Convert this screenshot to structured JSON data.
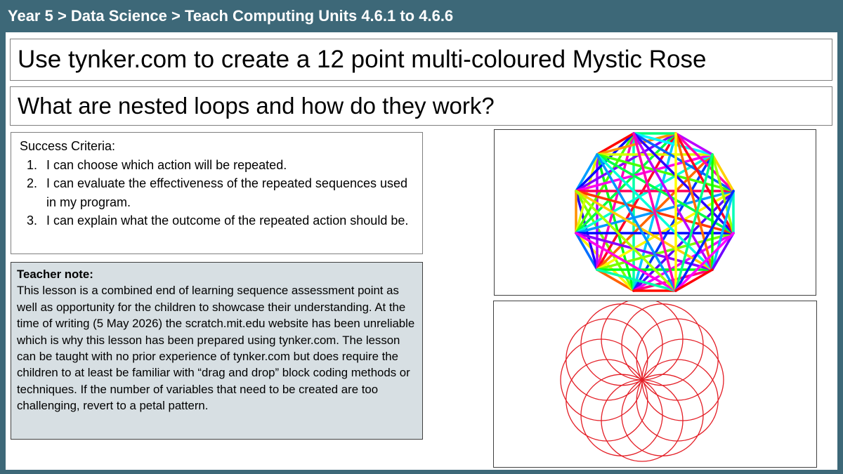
{
  "header": {
    "breadcrumb": "Year 5 > Data Science > Teach Computing Units 4.6.1 to 4.6.6"
  },
  "lesson": {
    "title": "Use tynker.com to create a 12 point multi-coloured Mystic Rose",
    "question": "What are nested loops and how do they work?"
  },
  "success_criteria": {
    "heading": "Success Criteria:",
    "items": [
      "I can choose which action will be repeated.",
      "I can evaluate the effectiveness of the repeated sequences used in my program.",
      "I can explain what the outcome of the repeated action should be."
    ]
  },
  "teacher_note": {
    "heading": "Teacher note:",
    "body": "This lesson is a combined end of learning sequence assessment point as well as opportunity for the children to showcase their understanding.  At the time of writing (5 May 2026) the scratch.mit.edu website has been unreliable which is why this lesson has been prepared using tynker.com.  The lesson can be taught with no prior experience of tynker.com but does require the children to at least be familiar with “drag and drop” block coding methods or techniques.  If the number of variables that need to be created are too challenging, revert to a petal pattern."
  },
  "images": {
    "mystic_rose": {
      "points": 12
    },
    "petal_pattern": {
      "petals": 12,
      "color": "#e41e26"
    }
  },
  "colors": {
    "header_bg": "#3d6878",
    "note_bg": "#d7dfe3"
  }
}
